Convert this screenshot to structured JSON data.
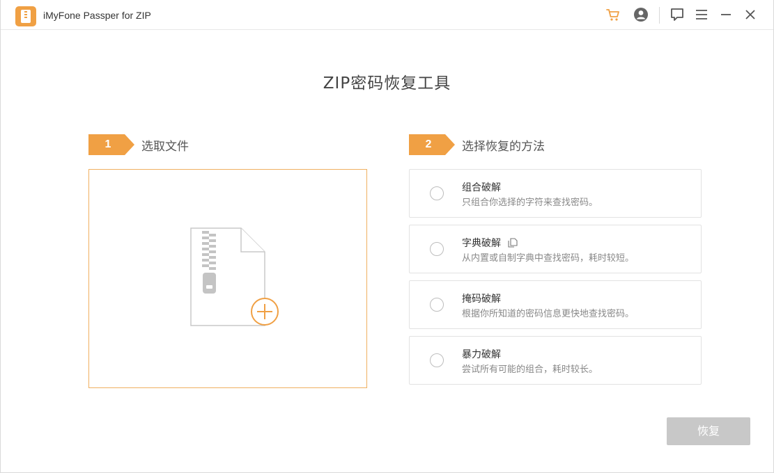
{
  "app": {
    "title": "iMyFone Passper for ZIP"
  },
  "titlebar": {
    "icons": [
      "cart-icon",
      "account-icon",
      "feedback-icon",
      "menu-icon",
      "minimize-icon",
      "close-icon"
    ]
  },
  "main": {
    "title": "ZIP密码恢复工具"
  },
  "step1": {
    "number": "1",
    "label": "选取文件"
  },
  "step2": {
    "number": "2",
    "label": "选择恢复的方法"
  },
  "options": [
    {
      "title": "组合破解",
      "desc": "只组合你选择的字符来查找密码。",
      "selected": false
    },
    {
      "title": "字典破解",
      "desc": "从内置或自制字典中查找密码，耗时较短。",
      "selected": false
    },
    {
      "title": "掩码破解",
      "desc": "根据你所知道的密码信息更快地查找密码。",
      "selected": false
    },
    {
      "title": "暴力破解",
      "desc": "尝试所有可能的组合，耗时较长。",
      "selected": false
    }
  ],
  "actions": {
    "recover_label": "恢复",
    "recover_enabled": false
  },
  "colors": {
    "accent": "#f0a044",
    "disabled_button": "#c8c8c8"
  }
}
